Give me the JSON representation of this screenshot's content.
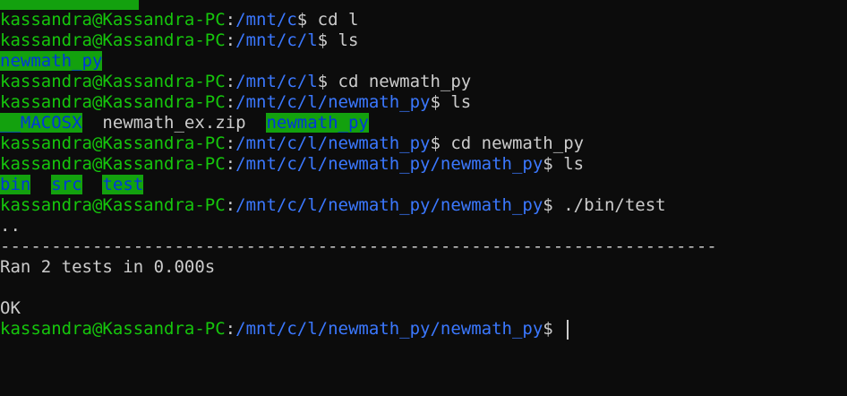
{
  "colors": {
    "background": "#0c0c0c",
    "user_host": "#16c60c",
    "path": "#3b78ff",
    "text": "#cccccc",
    "dir_highlight_bg": "#13a10e",
    "dir_highlight_fg": "#0037da"
  },
  "lines": [
    {
      "kind": "cutoff"
    },
    {
      "kind": "prompt",
      "user": "kassandra@Kassandra-PC",
      "sep": ":",
      "path": "/mnt/c",
      "symbol": "$ ",
      "cmd": "cd l"
    },
    {
      "kind": "prompt",
      "user": "kassandra@Kassandra-PC",
      "sep": ":",
      "path": "/mnt/c/l",
      "symbol": "$ ",
      "cmd": "ls"
    },
    {
      "kind": "ls",
      "items": [
        {
          "name": "newmath_py",
          "dir": true
        }
      ]
    },
    {
      "kind": "prompt",
      "user": "kassandra@Kassandra-PC",
      "sep": ":",
      "path": "/mnt/c/l",
      "symbol": "$ ",
      "cmd": "cd newmath_py"
    },
    {
      "kind": "prompt",
      "user": "kassandra@Kassandra-PC",
      "sep": ":",
      "path": "/mnt/c/l/newmath_py",
      "symbol": "$ ",
      "cmd": "ls"
    },
    {
      "kind": "ls",
      "items": [
        {
          "name": "__MACOSX",
          "dir": true
        },
        {
          "name": "newmath_ex.zip",
          "dir": false
        },
        {
          "name": "newmath_py",
          "dir": true
        }
      ]
    },
    {
      "kind": "prompt",
      "user": "kassandra@Kassandra-PC",
      "sep": ":",
      "path": "/mnt/c/l/newmath_py",
      "symbol": "$ ",
      "cmd": "cd newmath_py"
    },
    {
      "kind": "prompt",
      "user": "kassandra@Kassandra-PC",
      "sep": ":",
      "path": "/mnt/c/l/newmath_py/newmath_py",
      "symbol": "$ ",
      "cmd": "ls"
    },
    {
      "kind": "ls",
      "items": [
        {
          "name": "bin",
          "dir": true
        },
        {
          "name": "src",
          "dir": true
        },
        {
          "name": "test",
          "dir": true
        }
      ]
    },
    {
      "kind": "prompt",
      "user": "kassandra@Kassandra-PC",
      "sep": ":",
      "path": "/mnt/c/l/newmath_py/newmath_py",
      "symbol": "$ ",
      "cmd": "./bin/test"
    },
    {
      "kind": "output",
      "text": ".."
    },
    {
      "kind": "output",
      "text": "----------------------------------------------------------------------"
    },
    {
      "kind": "output",
      "text": "Ran 2 tests in 0.000s"
    },
    {
      "kind": "output",
      "text": ""
    },
    {
      "kind": "output",
      "text": "OK"
    },
    {
      "kind": "prompt",
      "user": "kassandra@Kassandra-PC",
      "sep": ":",
      "path": "/mnt/c/l/newmath_py/newmath_py",
      "symbol": "$ ",
      "cmd": "",
      "cursor": true
    }
  ]
}
